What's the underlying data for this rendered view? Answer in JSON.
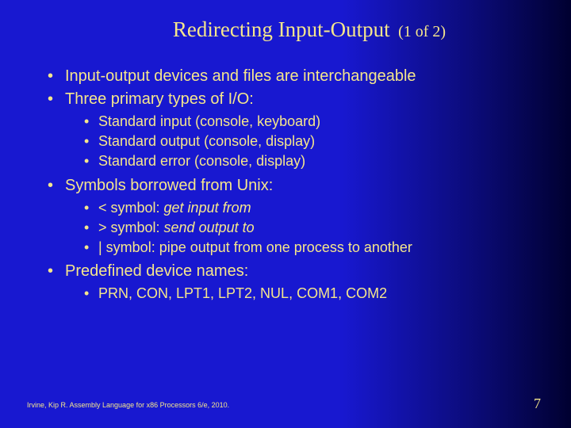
{
  "title": "Redirecting Input-Output",
  "subtitle": "(1 of 2)",
  "bullets": {
    "b1": "Input-output devices and files are interchangeable",
    "b2": "Three primary types of I/O:",
    "b2_1": "Standard input (console, keyboard)",
    "b2_2": "Standard output (console, display)",
    "b2_3": "Standard error (console, display)",
    "b3": "Symbols borrowed from Unix:",
    "b3_1a": "< symbol: ",
    "b3_1b": "get input from",
    "b3_2a": "> symbol: ",
    "b3_2b": "send output to",
    "b3_3": "| symbol: pipe output from one process to another",
    "b4": "Predefined device names:",
    "b4_1": "PRN, CON, LPT1, LPT2, NUL, COM1, COM2"
  },
  "footer": "Irvine, Kip R. Assembly Language for x86 Processors 6/e, 2010.",
  "page": "7"
}
